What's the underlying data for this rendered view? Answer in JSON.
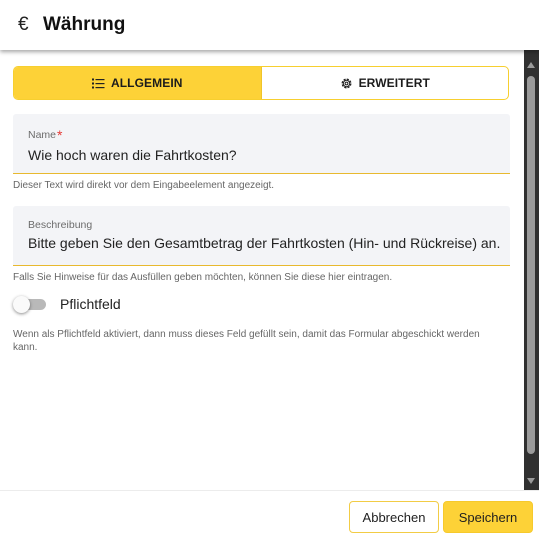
{
  "header": {
    "icon": "euro-icon",
    "title": "Währung"
  },
  "tabs": [
    {
      "label": "ALLGEMEIN",
      "icon": "list-icon",
      "active": true
    },
    {
      "label": "ERWEITERT",
      "icon": "gear-icon",
      "active": false
    }
  ],
  "fields": {
    "name": {
      "label": "Name",
      "required_marker": "*",
      "value": "Wie hoch waren die Fahrtkosten?",
      "hint": "Dieser Text wird direkt vor dem Eingabeelement angezeigt."
    },
    "description": {
      "label": "Beschreibung",
      "value": "Bitte geben Sie den Gesamtbetrag der Fahrtkosten (Hin- und Rückreise) an.",
      "hint": "Falls Sie Hinweise für das Ausfüllen geben möchten, können Sie diese hier eintragen."
    }
  },
  "required_toggle": {
    "label": "Pflichtfeld",
    "checked": false,
    "hint": "Wenn als Pflichtfeld aktiviert, dann muss dieses Feld gefüllt sein, damit das Formular abgeschickt werden kann."
  },
  "footer": {
    "cancel_label": "Abbrechen",
    "save_label": "Speichern"
  },
  "colors": {
    "accent": "#fdd237",
    "required": "#e53935",
    "field_bg": "#f3f4f7"
  }
}
